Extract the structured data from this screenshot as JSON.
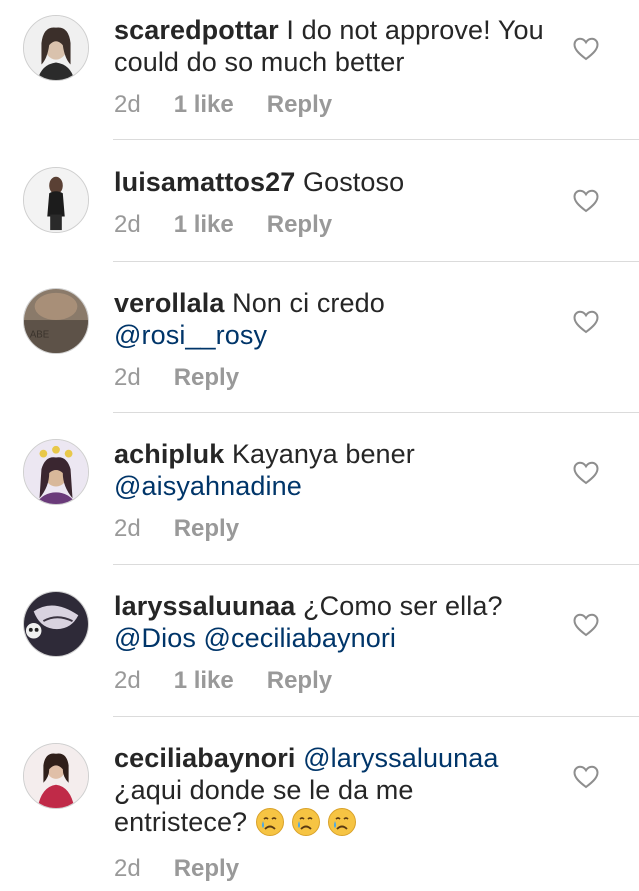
{
  "comments": [
    {
      "username": "scaredpottar",
      "text": "I do not approve! You could do so much better",
      "mentions": "",
      "time": "2d",
      "likes": "1 like",
      "reply": "Reply"
    },
    {
      "username": "luisamattos27",
      "text": "Gostoso",
      "mentions": "",
      "time": "2d",
      "likes": "1 like",
      "reply": "Reply"
    },
    {
      "username": "verollala",
      "text": "Non ci credo",
      "mentions": "@rosi__rosy",
      "time": "2d",
      "likes": "",
      "reply": "Reply"
    },
    {
      "username": "achipluk",
      "text": "Kayanya bener",
      "mentions": "@aisyahnadine",
      "time": "2d",
      "likes": "",
      "reply": "Reply"
    },
    {
      "username": "laryssaluunaa",
      "text": "¿Como ser ella?",
      "mentions": "@Dios @ceciliabaynori",
      "time": "2d",
      "likes": "1 like",
      "reply": "Reply"
    },
    {
      "username": "ceciliabaynori",
      "mentions": "@laryssaluunaa",
      "text": "¿aqui donde se le da me",
      "text2": "entristece?",
      "emojis": [
        "crying-face",
        "crying-face",
        "crying-face"
      ],
      "time": "2d",
      "likes": "",
      "reply": "Reply"
    }
  ],
  "colors": {
    "text": "#262626",
    "mention": "#003569",
    "meta": "#999999",
    "divider": "#dbdbdb"
  },
  "icons": {
    "like": "heart-outline-icon"
  }
}
